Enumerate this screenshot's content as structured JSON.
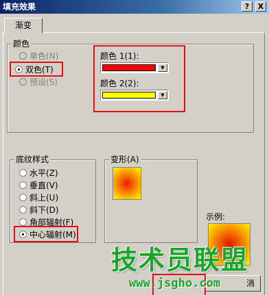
{
  "window": {
    "title": "填充效果",
    "help_btn": "?",
    "close_btn": "X"
  },
  "tabs": [
    {
      "label": "渐变"
    }
  ],
  "colors_group": {
    "label": "颜色",
    "options": [
      {
        "label": "单色(N)",
        "checked": false,
        "disabled": true
      },
      {
        "label": "双色(T)",
        "checked": true,
        "disabled": false
      },
      {
        "label": "预设(S)",
        "checked": false,
        "disabled": true
      }
    ],
    "color1": {
      "label": "颜色 1(1):",
      "value_hex": "#ff0000"
    },
    "color2": {
      "label": "颜色 2(2):",
      "value_hex": "#ffff00"
    }
  },
  "shading_group": {
    "label": "底纹样式",
    "options": [
      {
        "label": "水平(Z)",
        "checked": false
      },
      {
        "label": "垂直(V)",
        "checked": false
      },
      {
        "label": "斜上(U)",
        "checked": false
      },
      {
        "label": "斜下(D)",
        "checked": false
      },
      {
        "label": "角部辐射(F)",
        "checked": false
      },
      {
        "label": "中心辐射(M)",
        "checked": true
      }
    ]
  },
  "variants": {
    "label": "变形(A)"
  },
  "sample": {
    "label": "示例:"
  },
  "cancel_button": {
    "label": "消"
  },
  "watermark": {
    "text": "技术员联盟",
    "url": "www.jsgho.com"
  },
  "accent_colors": {
    "highlight_border": "#e01010",
    "watermark_green": "#1aa52a"
  }
}
